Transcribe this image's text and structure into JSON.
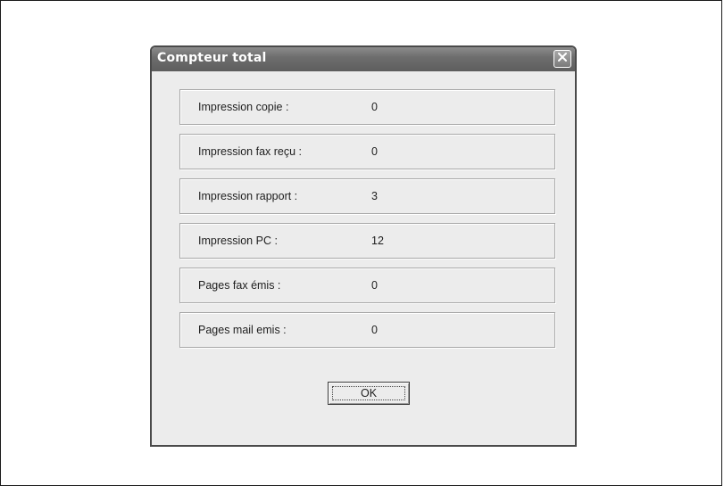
{
  "dialog": {
    "title": "Compteur total",
    "close_icon": "close-icon",
    "rows": [
      {
        "label": "Impression copie :",
        "value": "0"
      },
      {
        "label": "Impression fax reçu :",
        "value": "0"
      },
      {
        "label": "Impression rapport :",
        "value": "3"
      },
      {
        "label": "Impression PC :",
        "value": "12"
      },
      {
        "label": "Pages fax émis :",
        "value": "0"
      },
      {
        "label": "Pages mail emis :",
        "value": "0"
      }
    ],
    "ok_label": "OK"
  }
}
